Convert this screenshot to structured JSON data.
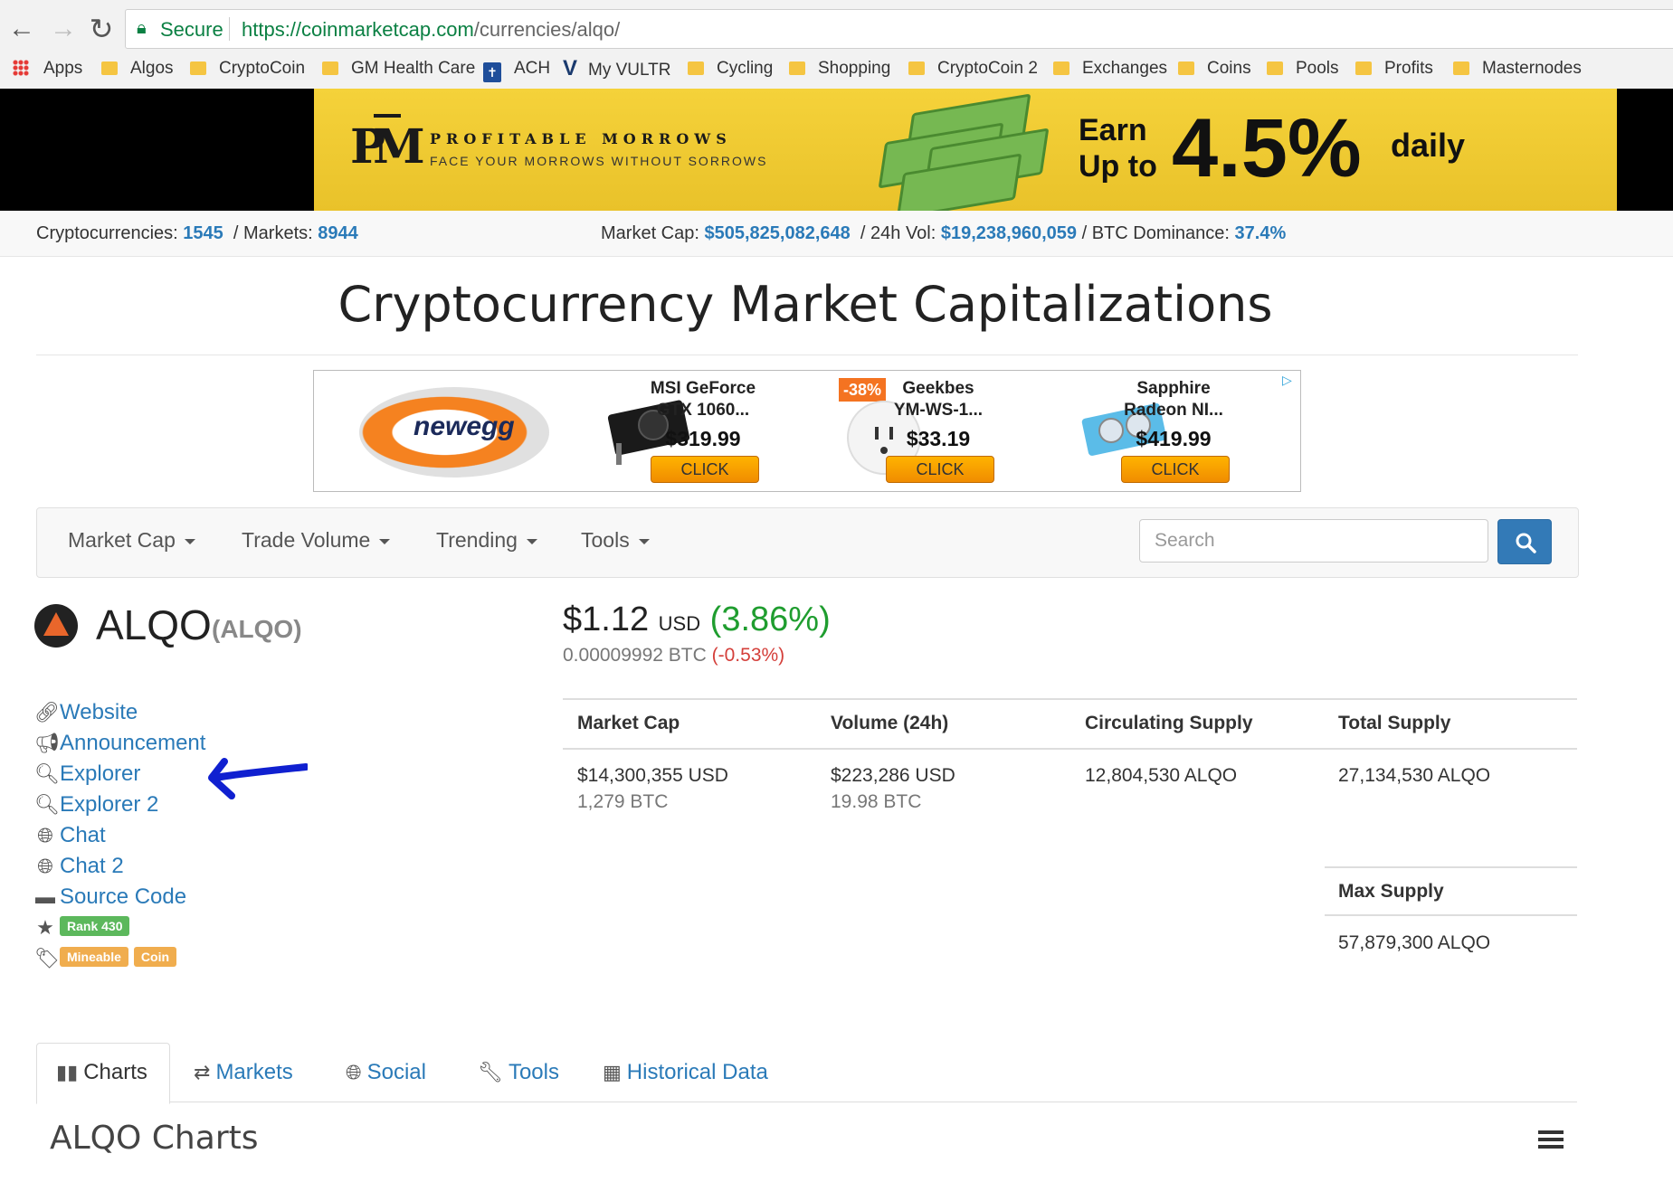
{
  "browser": {
    "secure_label": "Secure",
    "url_host": "https://coinmarketcap.com",
    "url_path": "/currencies/alqo/",
    "bookmarks": [
      {
        "label": "Apps",
        "icon": "apps-grid-icon"
      },
      {
        "label": "Algos",
        "icon": "folder-icon"
      },
      {
        "label": "CryptoCoin",
        "icon": "folder-icon"
      },
      {
        "label": "GM Health Care",
        "icon": "folder-icon"
      },
      {
        "label": "ACH",
        "icon": "ach-icon"
      },
      {
        "label": "My VULTR",
        "icon": "vultr-icon"
      },
      {
        "label": "Cycling",
        "icon": "folder-icon"
      },
      {
        "label": "Shopping",
        "icon": "folder-icon"
      },
      {
        "label": "CryptoCoin 2",
        "icon": "folder-icon"
      },
      {
        "label": "Exchanges",
        "icon": "folder-icon"
      },
      {
        "label": "Coins",
        "icon": "folder-icon"
      },
      {
        "label": "Pools",
        "icon": "folder-icon"
      },
      {
        "label": "Profits",
        "icon": "folder-icon"
      },
      {
        "label": "Masternodes",
        "icon": "folder-icon"
      }
    ]
  },
  "banner": {
    "brand_name": "PROFITABLE MORROWS",
    "brand_tagline": "FACE YOUR MORROWS WITHOUT SORROWS",
    "earn_line1": "Earn",
    "earn_line2": "Up to",
    "earn_pct": "4.5%",
    "earn_daily": "daily",
    "brand_color": "#f2cd30"
  },
  "global_stats": {
    "cryptocurrencies_label": "Cryptocurrencies:",
    "cryptocurrencies": "1545",
    "markets_label": "/ Markets:",
    "markets": "8944",
    "market_cap_label": "Market Cap:",
    "market_cap": "$505,825,082,648",
    "vol_label": "/ 24h Vol:",
    "vol": "$19,238,960,059",
    "dominance_label": "/ BTC Dominance:",
    "dominance": "37.4%"
  },
  "page_title": "Cryptocurrency Market Capitalizations",
  "ad": {
    "brand": "newegg",
    "discount": "-38%",
    "products": [
      {
        "name_line1": "MSI GeForce",
        "name_line2": "GTX 1060...",
        "price": "$319.99",
        "button": "CLICK"
      },
      {
        "name_line1": "Geekbes",
        "name_line2": "YM-WS-1...",
        "price": "$33.19",
        "button": "CLICK"
      },
      {
        "name_line1": "Sapphire",
        "name_line2": "Radeon NI...",
        "price": "$419.99",
        "button": "CLICK"
      }
    ]
  },
  "navbar": {
    "items": [
      "Market Cap",
      "Trade Volume",
      "Trending",
      "Tools"
    ],
    "search_placeholder": "Search"
  },
  "coin": {
    "name": "ALQO",
    "symbol": "(ALQO)",
    "price": "$1.12",
    "price_unit": "USD",
    "price_change": "(3.86%)",
    "btc_price": "0.00009992 BTC",
    "btc_change": "(-0.53%)",
    "accent_color": "#e9662b"
  },
  "links": [
    {
      "label": "Website",
      "icon": "link-icon"
    },
    {
      "label": "Announcement",
      "icon": "megaphone-icon"
    },
    {
      "label": "Explorer",
      "icon": "search-icon"
    },
    {
      "label": "Explorer 2",
      "icon": "search-icon"
    },
    {
      "label": "Chat",
      "icon": "globe-icon"
    },
    {
      "label": "Chat 2",
      "icon": "globe-icon"
    },
    {
      "label": "Source Code",
      "icon": "hdd-icon"
    }
  ],
  "rank_label": "Rank 430",
  "tags": [
    "Mineable",
    "Coin"
  ],
  "stats_table": {
    "headers": [
      "Market Cap",
      "Volume (24h)",
      "Circulating Supply",
      "Total Supply"
    ],
    "main": [
      "$14,300,355 USD",
      "$223,286 USD",
      "12,804,530 ALQO",
      "27,134,530 ALQO"
    ],
    "sub": [
      "1,279 BTC",
      "19.98 BTC",
      "",
      ""
    ],
    "max_supply_header": "Max Supply",
    "max_supply": "57,879,300 ALQO"
  },
  "tabs": [
    {
      "label": "Charts",
      "icon": "bar-chart-icon"
    },
    {
      "label": "Markets",
      "icon": "transfer-icon"
    },
    {
      "label": "Social",
      "icon": "globe-icon"
    },
    {
      "label": "Tools",
      "icon": "wrench-icon"
    },
    {
      "label": "Historical Data",
      "icon": "calendar-icon"
    }
  ],
  "charts_heading": "ALQO Charts",
  "colors": {
    "link": "#2a7ab8",
    "positive": "#1f9d2f",
    "negative": "#d43f3a",
    "rank_badge": "#5cb85c",
    "tag_badge": "#f0ad4e",
    "annotation_arrow": "#1020d0"
  }
}
